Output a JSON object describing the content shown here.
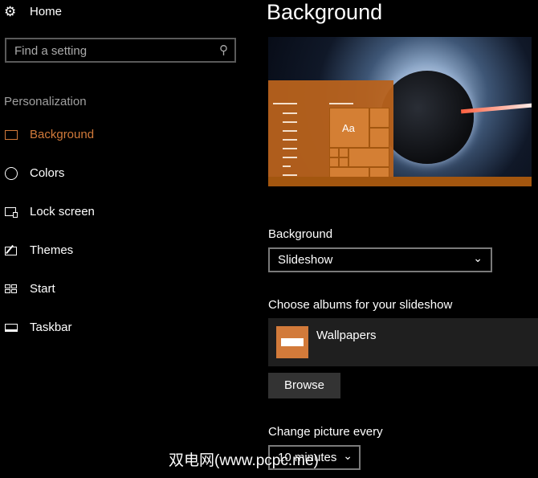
{
  "sidebar": {
    "home": "Home",
    "search_placeholder": "Find a setting",
    "section": "Personalization",
    "items": [
      {
        "label": "Background",
        "icon": "picture-icon"
      },
      {
        "label": "Colors",
        "icon": "palette-icon"
      },
      {
        "label": "Lock screen",
        "icon": "lock-screen-icon"
      },
      {
        "label": "Themes",
        "icon": "themes-icon"
      },
      {
        "label": "Start",
        "icon": "start-icon"
      },
      {
        "label": "Taskbar",
        "icon": "taskbar-icon"
      }
    ]
  },
  "main": {
    "title": "Background",
    "preview_tile_text": "Aa",
    "background_label": "Background",
    "background_value": "Slideshow",
    "albums_label": "Choose albums for your slideshow",
    "album_name": "Wallpapers",
    "browse": "Browse",
    "change_label": "Change picture every",
    "change_value": "10 minutes"
  },
  "watermark": "双电网(www.pcpc.me)",
  "colors": {
    "accent": "#d27a3a"
  }
}
